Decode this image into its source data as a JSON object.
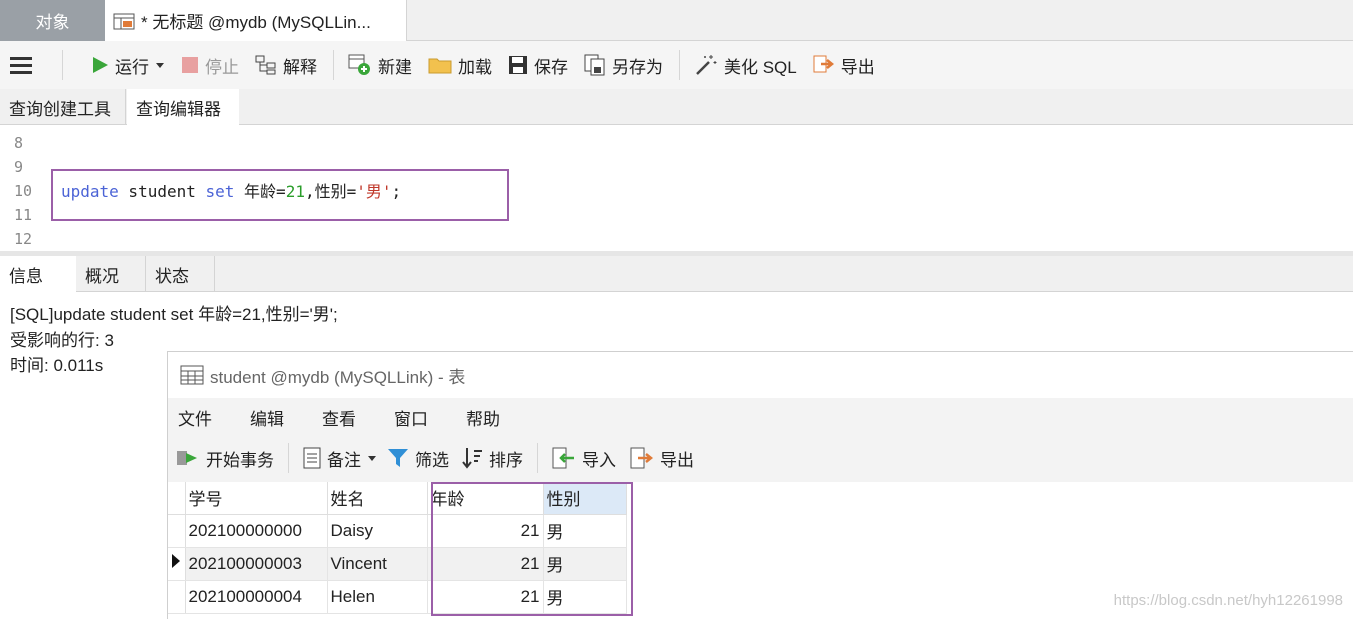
{
  "tabs": {
    "objects": "对象",
    "query_title": "* 无标题 @mydb (MySQLLin..."
  },
  "toolbar": {
    "run": "运行",
    "stop": "停止",
    "explain": "解释",
    "new": "新建",
    "load": "加载",
    "save": "保存",
    "save_as": "另存为",
    "beautify": "美化 SQL",
    "export": "导出"
  },
  "subtabs": {
    "builder": "查询创建工具",
    "editor": "查询编辑器"
  },
  "editor": {
    "line_numbers": [
      "8",
      "9",
      "10",
      "11",
      "12"
    ],
    "sql": {
      "kw1": "update",
      "t1": " student ",
      "kw2": "set",
      "t2": " 年龄=",
      "num": "21",
      "t3": ",性别=",
      "str": "'男'",
      "t4": ";"
    }
  },
  "result_tabs": {
    "info": "信息",
    "overview": "概况",
    "status": "状态"
  },
  "messages": [
    "[SQL]update student set 年龄=21,性别='男';",
    "受影响的行: 3",
    "时间: 0.011s"
  ],
  "table_window": {
    "title": "student @mydb (MySQLLink) - 表",
    "menu": [
      "文件",
      "编辑",
      "查看",
      "窗口",
      "帮助"
    ],
    "toolbar": {
      "begin_tx": "开始事务",
      "notes": "备注",
      "filter": "筛选",
      "sort": "排序",
      "import": "导入",
      "export": "导出"
    },
    "columns": [
      "学号",
      "姓名",
      "年龄",
      "性别"
    ],
    "rows": [
      [
        "202100000000",
        "Daisy",
        "21",
        "男"
      ],
      [
        "202100000003",
        "Vincent",
        "21",
        "男"
      ],
      [
        "202100000004",
        "Helen",
        "21",
        "男"
      ]
    ],
    "current_row": 1
  },
  "watermark": "https://blog.csdn.net/hyh12261998"
}
